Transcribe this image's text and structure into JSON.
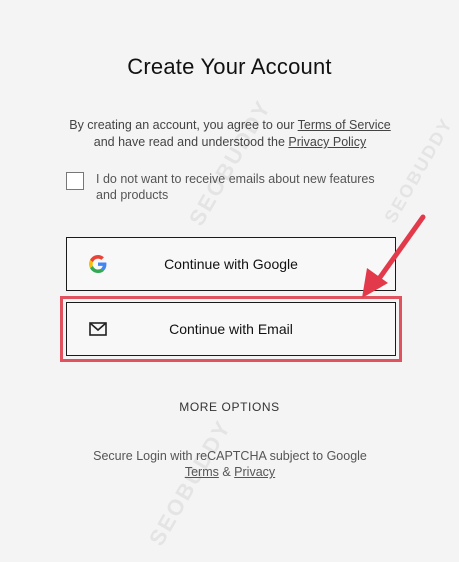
{
  "page": {
    "title": "Create Your Account"
  },
  "consent": {
    "prefix": "By creating an account, you agree to our",
    "terms_link": "Terms of Service",
    "middle": "and have read and understood the",
    "privacy_link": "Privacy Policy"
  },
  "email_opt_out": {
    "label": "I do not want to receive emails about new features and products",
    "checked": false
  },
  "buttons": {
    "google_label": "Continue with Google",
    "email_label": "Continue with Email"
  },
  "more_options": "MORE OPTIONS",
  "recaptcha": {
    "text": "Secure Login with reCAPTCHA subject to Google",
    "terms_link": "Terms",
    "separator": "&",
    "privacy_link": "Privacy"
  },
  "watermark": {
    "text": "SEOBUDDY",
    "subtext": "SEOBUDDY.COM"
  },
  "colors": {
    "highlight": "#e0535e",
    "arrow": "#e23a4b",
    "google_blue": "#4285F4",
    "google_red": "#EA4335",
    "google_yellow": "#FBBC05",
    "google_green": "#34A853"
  }
}
